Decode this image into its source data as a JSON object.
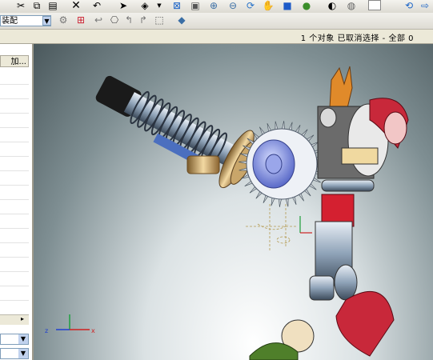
{
  "toolbar": {
    "assembly_select": "装配",
    "icons": [
      "cut-icon",
      "copy-icon",
      "paste-icon",
      "delete-icon",
      "undo-icon",
      "cursor-icon",
      "dropdown-icon",
      "fit-icon",
      "zoom-window-icon",
      "zoom-icon",
      "rotate-icon",
      "pan-icon",
      "shaded-view-icon",
      "render-icon",
      "light-icon",
      "background-icon",
      "refresh-icon"
    ],
    "row2_icons": [
      "filter-icon",
      "select-icon",
      "undo-select-icon",
      "rotate-view-icon",
      "prev-view-icon",
      "next-view-icon",
      "box-select-icon",
      "cube-icon"
    ]
  },
  "status": {
    "text": "1 个对象 已取消选择  - 全部 0"
  },
  "left_panel": {
    "header": "加..."
  },
  "viewport": {
    "background_top": "#4a585c",
    "background_bottom": "#ffffff",
    "axis_labels": [
      "z",
      "x"
    ]
  }
}
